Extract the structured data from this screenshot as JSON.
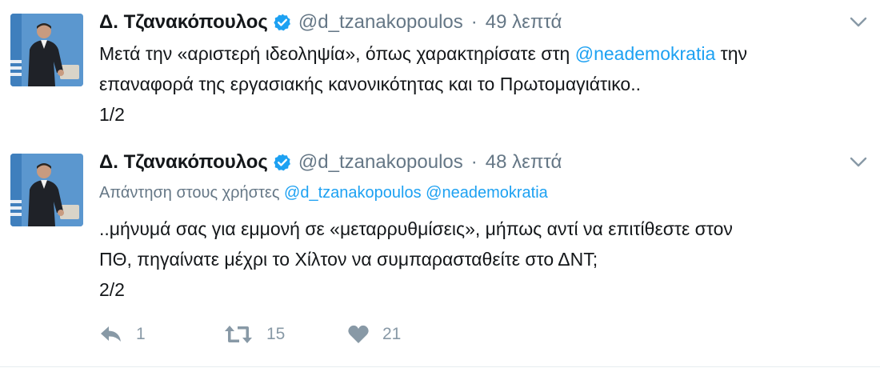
{
  "tweets": [
    {
      "fullname": "Δ. Τζανακόπουλος",
      "username": "@d_tzanakopoulos",
      "separator": "·",
      "time": "49 λεπτά",
      "lines": [
        {
          "before": "Μετά την «αριστερή ιδεοληψία», όπως χαρακτηρίσατε στη ",
          "mention": "@neademokratia",
          "after": " την"
        },
        {
          "text": "επαναφορά της εργασιακής κανονικότητας και το Πρωτομαγιάτικο.."
        },
        {
          "text": "1/2"
        }
      ]
    },
    {
      "fullname": "Δ. Τζανακόπουλος",
      "username": "@d_tzanakopoulos",
      "separator": "·",
      "time": "48 λεπτά",
      "reply_context": {
        "prefix": "Απάντηση στους χρήστες",
        "mention_1": "@d_tzanakopoulos",
        "mention_2": "@neademokratia"
      },
      "lines": [
        {
          "text": "..μήνυμά σας για εμμονή σε «μεταρρυθμίσεις», μήπως αντί να επιτίθεστε στον"
        },
        {
          "text": "ΠΘ, πηγαίνατε μέχρι το Χίλτον να συμπαρασταθείτε στο ΔΝΤ;"
        },
        {
          "text": "2/2"
        }
      ],
      "actions": {
        "reply_count": "1",
        "retweet_count": "15",
        "like_count": "21"
      }
    }
  ],
  "icons": {
    "verified": "verified-badge-icon",
    "caret": "chevron-down-icon",
    "reply": "reply-icon",
    "retweet": "retweet-icon",
    "like": "heart-icon"
  },
  "colors": {
    "text": "#14171a",
    "secondary": "#657786",
    "mention": "#1da1f2",
    "verified": "#1da1f2",
    "action": "#8899a6",
    "divider": "#e6ecf0"
  }
}
